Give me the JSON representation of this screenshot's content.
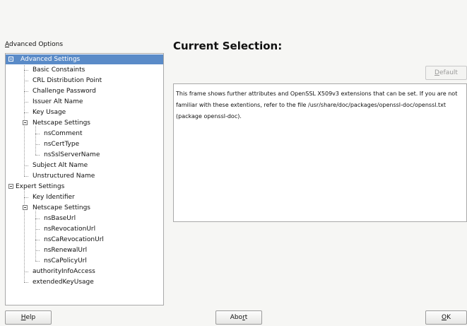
{
  "left_panel": {
    "label_prefix": "",
    "label_accel": "A",
    "label_rest": "dvanced Options"
  },
  "tree": {
    "nodes": [
      {
        "label": "Advanced Settings",
        "level": 0,
        "expandable": true,
        "selected": true
      },
      {
        "label": "Basic Constaints",
        "level": 1
      },
      {
        "label": "CRL Distribution Point",
        "level": 1
      },
      {
        "label": "Challenge Password",
        "level": 1
      },
      {
        "label": "Issuer Alt Name",
        "level": 1
      },
      {
        "label": "Key Usage",
        "level": 1
      },
      {
        "label": "Netscape Settings",
        "level": 1,
        "expandable": true
      },
      {
        "label": "nsComment",
        "level": 2
      },
      {
        "label": "nsCertType",
        "level": 2
      },
      {
        "label": "nsSslServerName",
        "level": 2
      },
      {
        "label": "Subject Alt Name",
        "level": 1
      },
      {
        "label": "Unstructured Name",
        "level": 1
      },
      {
        "label": "Expert Settings",
        "level": 0,
        "expandable": true
      },
      {
        "label": "Key Identifier",
        "level": 1
      },
      {
        "label": "Netscape Settings",
        "level": 1,
        "expandable": true
      },
      {
        "label": "nsBaseUrl",
        "level": 2
      },
      {
        "label": "nsRevocationUrl",
        "level": 2
      },
      {
        "label": "nsCaRevocationUrl",
        "level": 2
      },
      {
        "label": "nsRenewalUrl",
        "level": 2
      },
      {
        "label": "nsCaPolicyUrl",
        "level": 2
      },
      {
        "label": "authorityInfoAccess",
        "level": 1
      },
      {
        "label": "extendedKeyUsage",
        "level": 1
      }
    ]
  },
  "main": {
    "heading": "Current Selection:",
    "default_button": {
      "accel": "D",
      "rest": "efault"
    },
    "info_text": "This frame shows further attributes and OpenSSL X509v3 extensions that can be set. If you are not familiar with these extentions, refer to the file /usr/share/doc/packages/openssl-doc/openssl.txt (package openssl-doc)."
  },
  "footer": {
    "help_button": {
      "accel": "H",
      "rest": "elp"
    },
    "abort_button": {
      "pre": "Abo",
      "accel": "r",
      "rest": "t"
    },
    "ok_button": {
      "accel": "O",
      "rest": "K"
    }
  },
  "colors": {
    "selection": "#5a8bc8",
    "background": "#f6f6f4"
  }
}
